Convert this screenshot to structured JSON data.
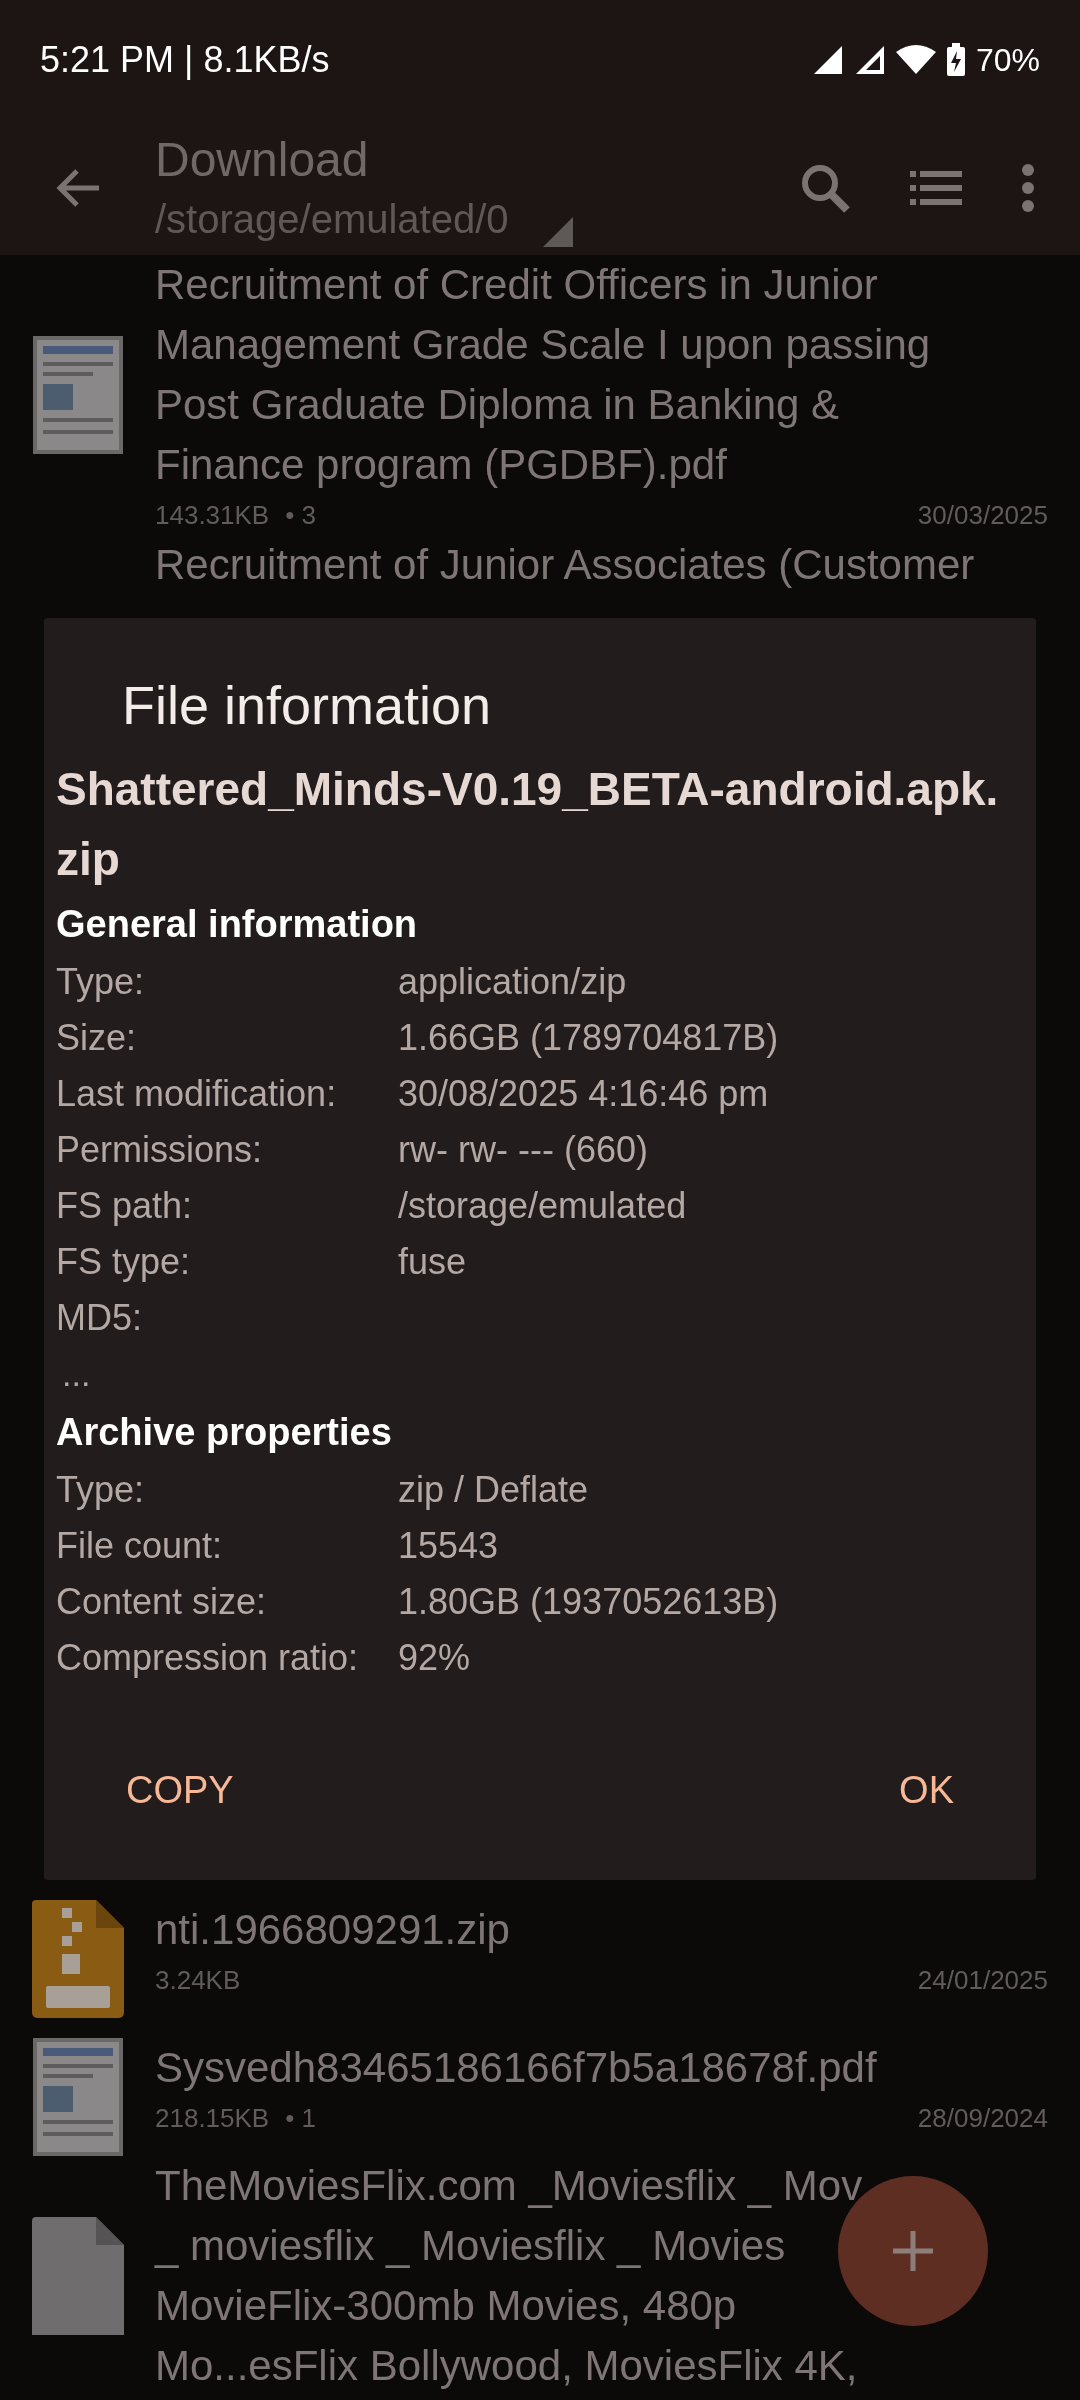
{
  "status_bar": {
    "time": "5:21 PM | 8.1KB/s",
    "battery": "70%"
  },
  "toolbar": {
    "title": "Download",
    "path": "/storage/emulated/0"
  },
  "files": [
    {
      "kind": "pdf",
      "title_lines": [
        "Recruitment of Credit Officers in Junior",
        "Management Grade Scale I upon passing",
        "Post Graduate Diploma in Banking &",
        "Finance program (PGDBF).pdf"
      ],
      "size": "143.31KB",
      "pages": "• 3",
      "date": "30/03/2025"
    },
    {
      "kind": "none",
      "title_lines": [
        "Recruitment of Junior Associates (Customer"
      ]
    },
    {
      "kind": "zip",
      "title_lines": [
        "nti.1966809291.zip"
      ],
      "size": "3.24KB",
      "date": "24/01/2025"
    },
    {
      "kind": "pdf",
      "title_lines": [
        "Sysvedh83465186166f7b5a18678f.pdf"
      ],
      "size": "218.15KB",
      "pages": "• 1",
      "date": "28/09/2024"
    },
    {
      "kind": "file",
      "title_lines": [
        "TheMoviesFlix.com _Moviesflix _ Mov",
        "_ moviesflix _ Moviesflix _ Movies",
        "MovieFlix-300mb Movies, 480p",
        "Mo...esFlix Bollywood, MoviesFlix 4K,"
      ]
    }
  ],
  "dialog": {
    "title": "File information",
    "filename": "Shattered_Minds-V0.19_BETA-android.apk.zip",
    "sections": [
      {
        "heading": "General information",
        "rows": [
          {
            "label": "Type:",
            "value": "application/zip"
          },
          {
            "label": "Size:",
            "value": "1.66GB (1789704817B)"
          },
          {
            "label": "Last modification:",
            "value": "30/08/2025 4:16:46 pm"
          },
          {
            "label": "Permissions:",
            "value": "rw- rw- --- (660)"
          },
          {
            "label": "FS path:",
            "value": "/storage/emulated"
          },
          {
            "label": "FS type:",
            "value": "fuse"
          },
          {
            "label": "MD5:"
          }
        ],
        "note": "..."
      },
      {
        "heading": "Archive properties",
        "rows": [
          {
            "label": "Type:",
            "value": "zip / Deflate"
          },
          {
            "label": "File count:",
            "value": "15543"
          },
          {
            "label": "Content size:",
            "value": "1.80GB (1937052613B)"
          },
          {
            "label": "Compression ratio:",
            "value": "92%"
          }
        ]
      }
    ],
    "buttons": [
      "COPY",
      "OK"
    ]
  }
}
